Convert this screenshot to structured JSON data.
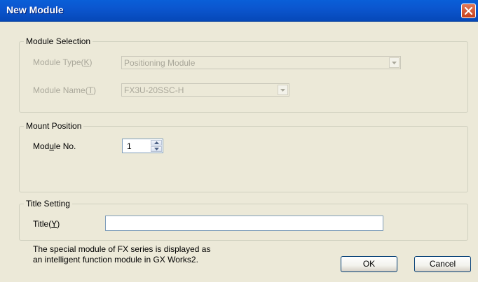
{
  "window": {
    "title": "New Module",
    "close_icon": "close-icon"
  },
  "module_selection": {
    "legend": "Module Selection",
    "module_type_label": "Module Type(",
    "module_type_accel": "K",
    "module_type_close": ")",
    "module_type_value": "Positioning Module",
    "module_name_label": "Module Name(",
    "module_name_accel": "T",
    "module_name_close": ")",
    "module_name_value": "FX3U-20SSC-H"
  },
  "mount_position": {
    "legend": "Mount Position",
    "module_no_label_pre": "Mod",
    "module_no_accel": "u",
    "module_no_label_post": "le No.",
    "module_no_value": "1"
  },
  "title_setting": {
    "legend": "Title Setting",
    "title_label": "Title(",
    "title_accel": "Y",
    "title_close": ")",
    "title_value": ""
  },
  "footer": {
    "note_line1": "The special module of FX series is displayed as",
    "note_line2": "an intelligent function module in GX Works2.",
    "ok_label": "OK",
    "cancel_label": "Cancel"
  },
  "colors": {
    "titlebar": "#0b56cf",
    "dialog_bg": "#ece9d8",
    "disabled_text": "#a9a79a",
    "close_button": "#c8401c"
  }
}
